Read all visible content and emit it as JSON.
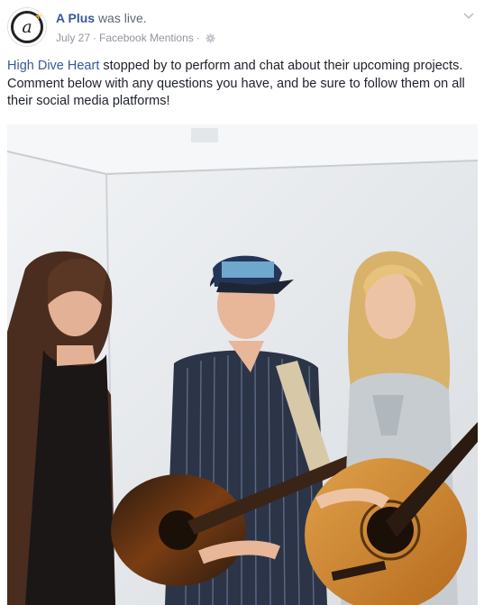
{
  "post": {
    "author": "A Plus",
    "action": "was live.",
    "date": "July 27",
    "source": "Facebook Mentions",
    "meta_separator": "·",
    "privacy_icon": "gear-icon",
    "text_link": "High Dive Heart",
    "text_rest": " stopped by to perform and chat about their upcoming projects. Comment below with any questions you have, and be sure to follow them on all their social media platforms!"
  },
  "avatar": {
    "letter": "a",
    "plus": "+"
  },
  "colors": {
    "link": "#365899",
    "meta": "#90949c",
    "brand_plus": "#f5a623"
  }
}
